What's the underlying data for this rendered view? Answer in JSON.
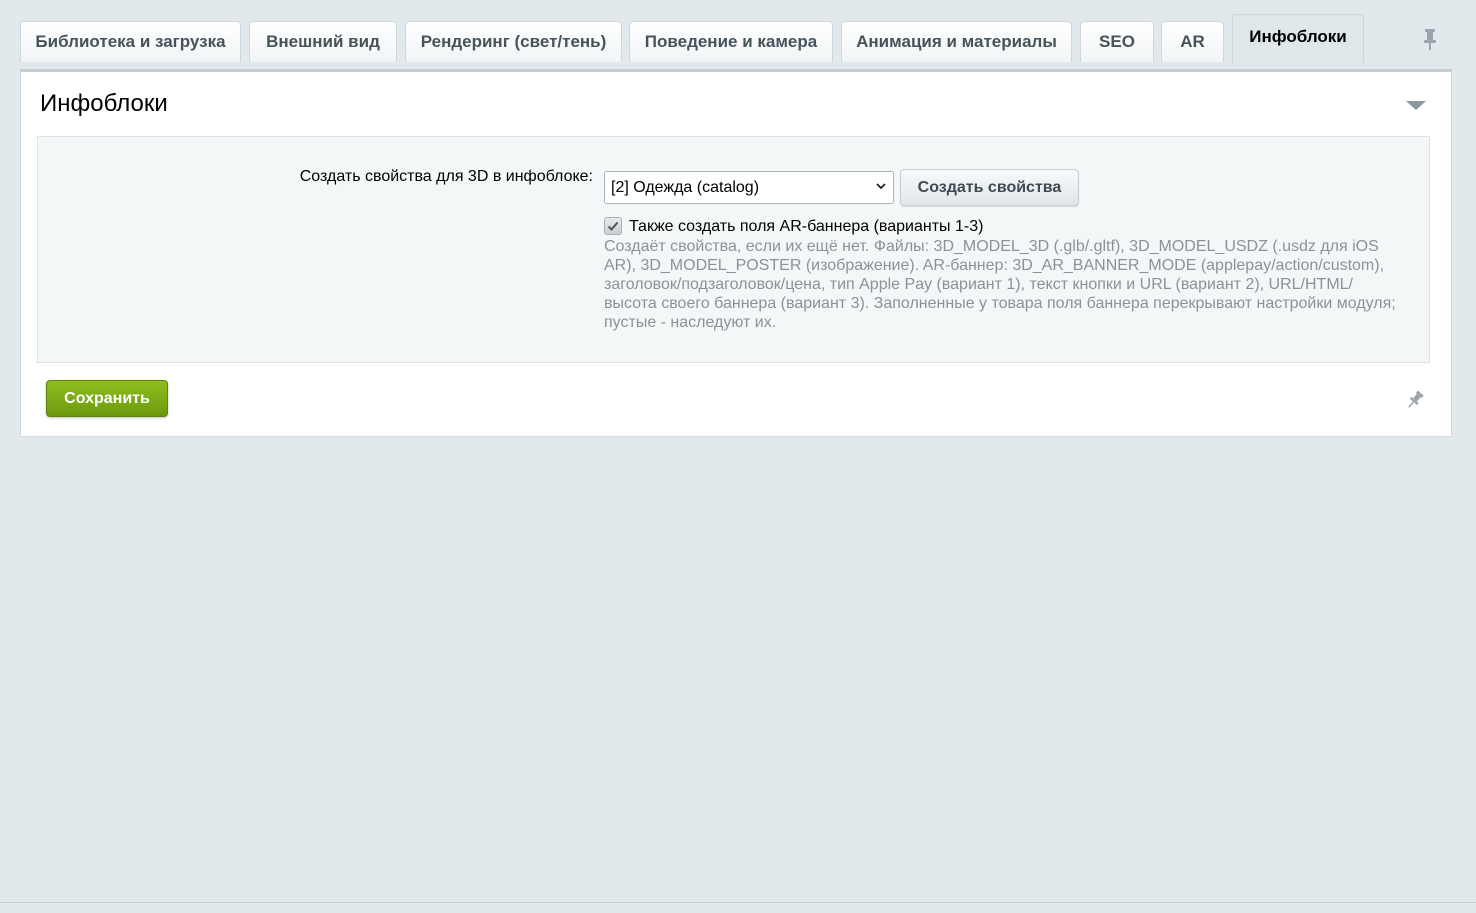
{
  "tabs": [
    {
      "label": "Библиотека и загрузка"
    },
    {
      "label": "Внешний вид"
    },
    {
      "label": "Рендеринг (свет/тень)"
    },
    {
      "label": "Поведение и камера"
    },
    {
      "label": "Анимация и материалы"
    },
    {
      "label": "SEO"
    },
    {
      "label": "AR"
    },
    {
      "label": "Инфоблоки",
      "active": true
    }
  ],
  "panel": {
    "title": "Инфоблоки",
    "field_label": "Создать свойства для 3D в инфоблоке:",
    "select_value": "[2] Одежда (catalog)",
    "create_button": "Создать свойства",
    "checkbox_checked": true,
    "checkbox_label": "Также создать поля AR-баннера (варианты 1-3)",
    "hint": "Создаёт свойства, если их ещё нет. Файлы: 3D_MODEL_3D (.glb/.gltf), 3D_MODEL_USDZ (.usdz для iOS AR), 3D_MODEL_POSTER (изображение). AR-баннер: 3D_AR_BANNER_MODE (applepay/action/custom), заголовок/подзаголовок/цена, тип Apple Pay (вариант 1), текст кнопки и URL (вариант 2), URL/HTML/высота своего баннера (вариант 3). Заполненные у товара поля баннера перекрывают настройки модуля; пустые - наследуют их."
  },
  "footer": {
    "save_button": "Сохранить"
  },
  "colors": {
    "background": "#e2e9ec",
    "save_button": "#7aab14",
    "hint_text": "#8b9295"
  },
  "icons": [
    "pin-icon",
    "collapse-arrow-icon",
    "chevron-down-icon",
    "checkmark-icon"
  ]
}
